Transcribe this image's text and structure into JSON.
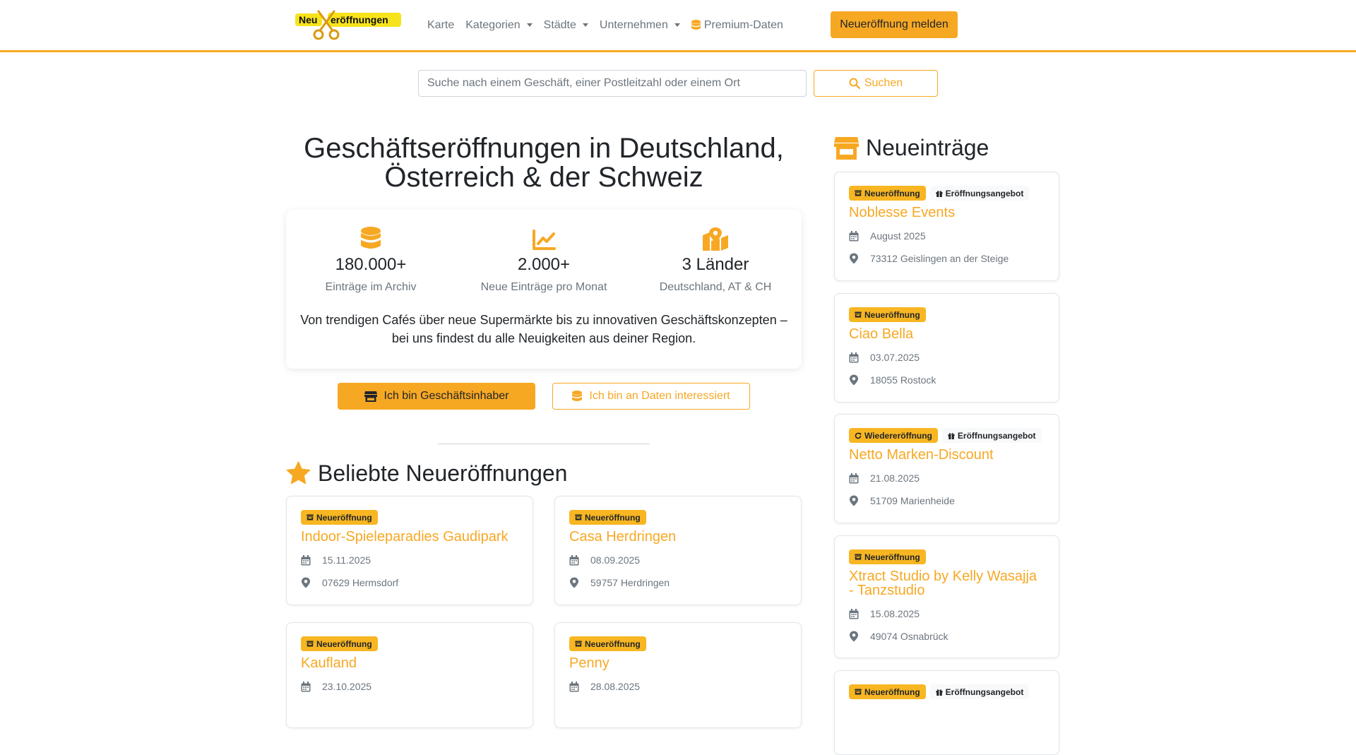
{
  "brand": {
    "logo_top": "Neu",
    "logo_rest": "eröffnungen",
    "accent": "#f7a823",
    "badge_color": "#f7b622"
  },
  "nav": {
    "items": [
      {
        "label": "Karte"
      },
      {
        "label": "Kategorien"
      },
      {
        "label": "Städte"
      },
      {
        "label": "Unternehmen"
      },
      {
        "label": "Premium-Daten"
      }
    ],
    "report_button": "Neueröffnung melden"
  },
  "search": {
    "placeholder": "Suche nach einem Geschäft, einer Postleitzahl oder einem Ort",
    "value": "",
    "button": "Suchen"
  },
  "hero": {
    "title_line1": "Geschäftseröffnungen in Deutschland,",
    "title_line2": "Österreich & der Schweiz",
    "stats": [
      {
        "icon": "database-icon",
        "value": "180.000+",
        "label": "Einträge im Archiv"
      },
      {
        "icon": "chart-line-icon",
        "value": "2.000+",
        "label": "Neue Einträge pro Monat"
      },
      {
        "icon": "map-icon",
        "value": "3 Länder",
        "label": "Deutschland, AT & CH"
      }
    ],
    "description": "Von trendigen Cafés über neue Supermärkte bis zu innovativen Geschäftskonzepten – bei uns findest du alle Neuigkeiten aus deiner Region.",
    "btn_owner": "Ich bin Geschäftsinhaber",
    "btn_data": "Ich bin an Daten interessiert"
  },
  "popular": {
    "title": "Beliebte Neueröffnungen",
    "cards": [
      {
        "badges": [
          {
            "type": "main",
            "icon": "store-icon",
            "label": "Neueröffnung"
          }
        ],
        "title": "Indoor-Spieleparadies Gaudipark",
        "date": "15.11.2025",
        "location": "07629 Hermsdorf"
      },
      {
        "badges": [
          {
            "type": "main",
            "icon": "store-icon",
            "label": "Neueröffnung"
          }
        ],
        "title": "Casa Herdringen",
        "date": "08.09.2025",
        "location": "59757 Herdringen"
      },
      {
        "badges": [
          {
            "type": "main",
            "icon": "store-icon",
            "label": "Neueröffnung"
          }
        ],
        "title": "Kaufland",
        "date": "23.10.2025",
        "location": ""
      },
      {
        "badges": [
          {
            "type": "main",
            "icon": "store-icon",
            "label": "Neueröffnung"
          }
        ],
        "title": "Penny",
        "date": "28.08.2025",
        "location": ""
      }
    ]
  },
  "recent": {
    "title": "Neueinträge",
    "cards": [
      {
        "badges": [
          {
            "type": "main",
            "icon": "store-icon",
            "label": "Neueröffnung"
          },
          {
            "type": "offer",
            "icon": "gift-icon",
            "label": "Eröffnungsangebot"
          }
        ],
        "title": "Noblesse Events",
        "title2": "",
        "date": "August 2025",
        "location": "73312 Geislingen an der Steige"
      },
      {
        "badges": [
          {
            "type": "main",
            "icon": "store-icon",
            "label": "Neueröffnung"
          }
        ],
        "title": "Ciao Bella",
        "title2": "",
        "date": "03.07.2025",
        "location": "18055 Rostock"
      },
      {
        "badges": [
          {
            "type": "main",
            "icon": "redo-icon",
            "label": "Wiedereröffnung"
          },
          {
            "type": "offer",
            "icon": "gift-icon",
            "label": "Eröffnungsangebot"
          }
        ],
        "title": "Netto Marken-Discount",
        "title2": "",
        "date": "21.08.2025",
        "location": "51709 Marienheide"
      },
      {
        "badges": [
          {
            "type": "main",
            "icon": "store-icon",
            "label": "Neueröffnung"
          }
        ],
        "title": "Xtract Studio by Kelly Wasajja",
        "title2": "- Tanzstudio",
        "date": "15.08.2025",
        "location": "49074 Osnabrück"
      },
      {
        "badges": [
          {
            "type": "main",
            "icon": "store-icon",
            "label": "Neueröffnung"
          },
          {
            "type": "offer",
            "icon": "gift-icon",
            "label": "Eröffnungsangebot"
          }
        ],
        "title": "",
        "title2": "",
        "date": "",
        "location": ""
      }
    ]
  }
}
